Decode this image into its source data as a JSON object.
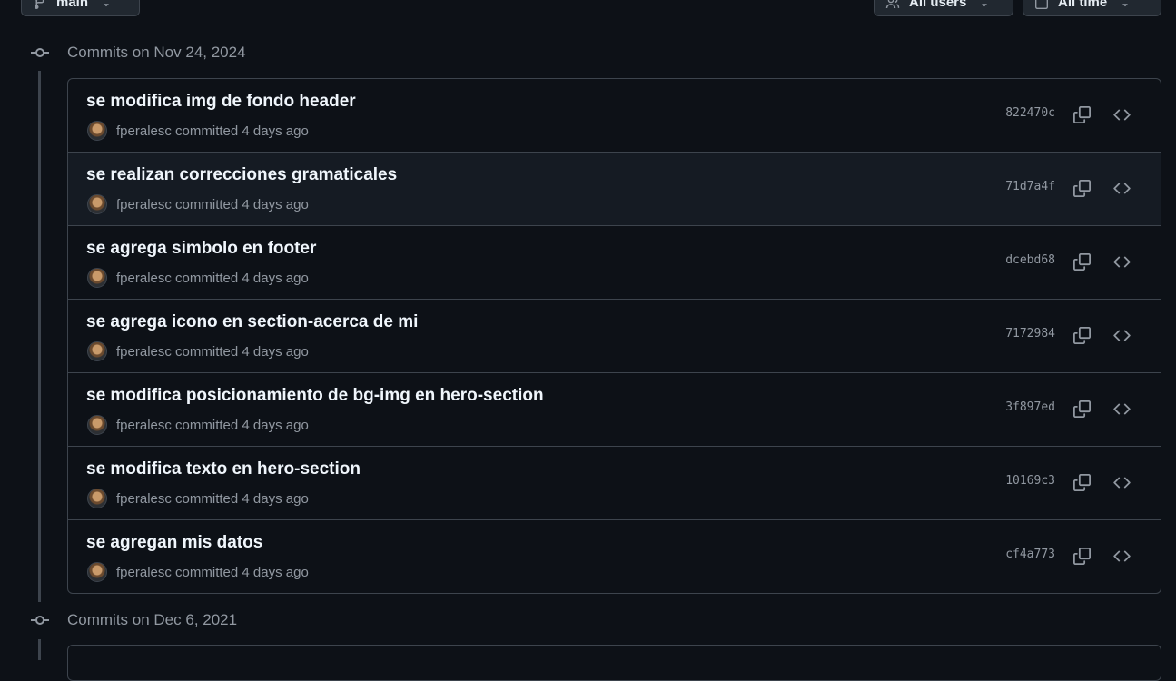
{
  "filters": {
    "branch": "main",
    "users": "All users",
    "time": "All time"
  },
  "groups": [
    {
      "title": "Commits on Nov 24, 2024",
      "commits": [
        {
          "message": "se modifica img de fondo header",
          "author": "fperalesc",
          "action": " committed 4 days ago",
          "sha": "822470c"
        },
        {
          "message": "se realizan correcciones gramaticales",
          "author": "fperalesc",
          "action": " committed 4 days ago",
          "sha": "71d7a4f"
        },
        {
          "message": "se agrega simbolo en footer",
          "author": "fperalesc",
          "action": " committed 4 days ago",
          "sha": "dcebd68"
        },
        {
          "message": "se agrega icono en section-acerca de mi",
          "author": "fperalesc",
          "action": " committed 4 days ago",
          "sha": "7172984"
        },
        {
          "message": "se modifica posicionamiento de bg-img en hero-section",
          "author": "fperalesc",
          "action": " committed 4 days ago",
          "sha": "3f897ed"
        },
        {
          "message": "se modifica texto en hero-section",
          "author": "fperalesc",
          "action": " committed 4 days ago",
          "sha": "10169c3"
        },
        {
          "message": "se agregan mis datos",
          "author": "fperalesc",
          "action": " committed 4 days ago",
          "sha": "cf4a773"
        }
      ]
    },
    {
      "title": "Commits on Dec 6, 2021",
      "commits": []
    }
  ],
  "icons": {
    "branch": "git-branch-icon",
    "users": "people-icon",
    "time": "calendar-icon",
    "node": "git-commit-icon",
    "copy": "copy-icon",
    "browse": "code-icon"
  }
}
